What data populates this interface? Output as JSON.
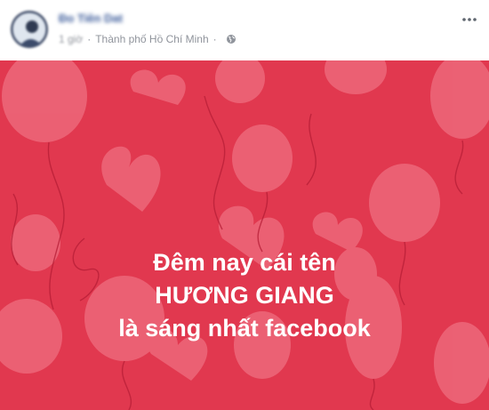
{
  "post": {
    "author_name": "Đo Tiên Dat",
    "time": "1 giờ",
    "location": "Thành phố Hồ Chí Minh",
    "separator": "·",
    "privacy_icon": "globe-icon",
    "menu_icon": "more-horizontal-icon",
    "avatar_icon": "user-avatar"
  },
  "status_background": {
    "color": "#e1384f",
    "pattern": "balloons-and-hearts",
    "lines": [
      "Đêm nay cái tên",
      "HƯƠNG GIANG",
      "là sáng nhất facebook"
    ]
  }
}
